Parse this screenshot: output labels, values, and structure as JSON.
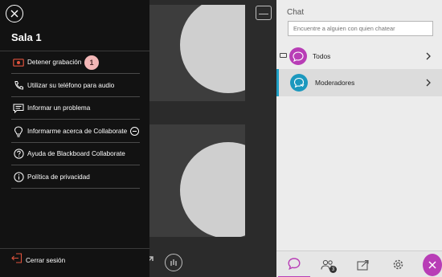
{
  "menu": {
    "title": "Sala 1",
    "items": [
      {
        "label": "Detener grabación",
        "icon": "recording-icon"
      },
      {
        "label": "Utilizar su teléfono para audio",
        "icon": "phone-icon"
      },
      {
        "label": "Informar un problema",
        "icon": "report-icon"
      },
      {
        "label": "Informarme acerca de Collaborate",
        "icon": "lightbulb-icon"
      },
      {
        "label": "Ayuda de Blackboard Collaborate",
        "icon": "help-icon"
      },
      {
        "label": "Política de privacidad",
        "icon": "info-icon"
      }
    ],
    "badge": "1",
    "logout_label": "Cerrar sesión"
  },
  "chat": {
    "title": "Chat",
    "search_placeholder": "Encuentre a alguien con quien chatear",
    "channels": [
      {
        "label": "Todos",
        "color": "#b83db6"
      },
      {
        "label": "Moderadores",
        "color": "#1b98be"
      }
    ],
    "attendee_count": "3"
  },
  "colors": {
    "menu_bg": "#121212",
    "accent_purple": "#b83db6",
    "accent_blue": "#1fa0c6",
    "record_red": "#e0533d"
  }
}
